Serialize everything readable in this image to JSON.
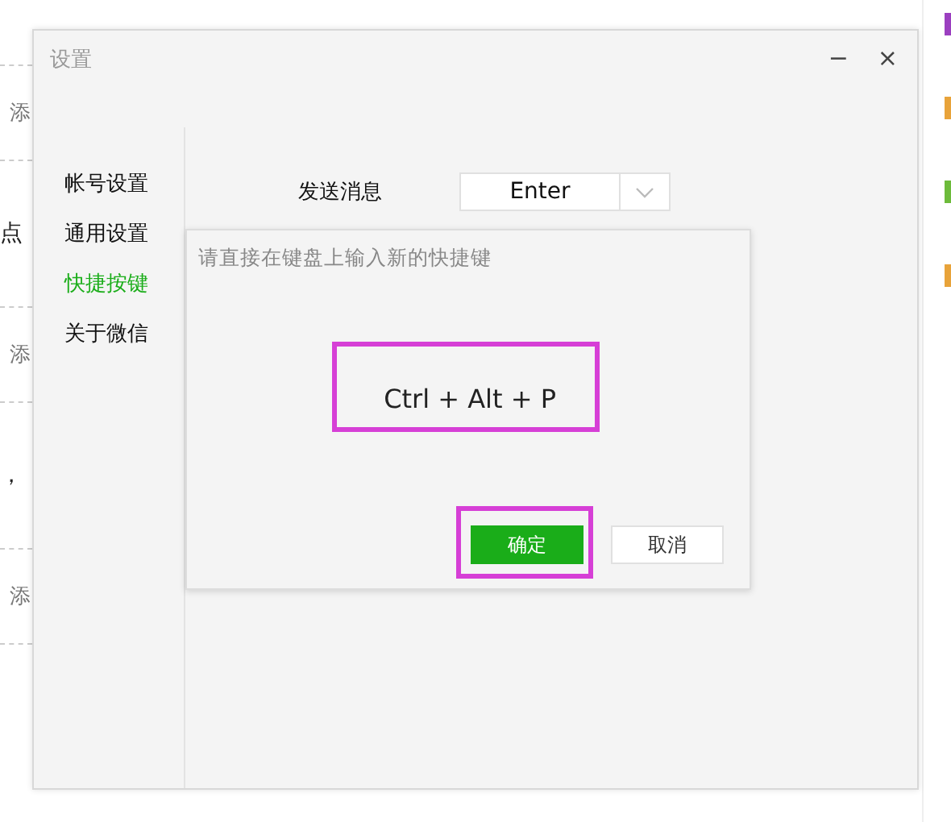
{
  "background": {
    "fragments": [
      {
        "text": "添",
        "kind": "box"
      },
      {
        "text": "点",
        "kind": "plain"
      },
      {
        "text": "添",
        "kind": "box"
      },
      {
        "text": "，",
        "kind": "plain"
      },
      {
        "text": "添",
        "kind": "box"
      }
    ],
    "side_marks": [
      {
        "color": "#9b3fc0"
      },
      {
        "color": "#e8a33a"
      },
      {
        "color": "#6dbb3b"
      },
      {
        "color": "#e8a33a"
      }
    ]
  },
  "window": {
    "title": "设置",
    "minimize": "−",
    "close": "×"
  },
  "sidebar": {
    "items": [
      {
        "label": "帐号设置",
        "selected": false
      },
      {
        "label": "通用设置",
        "selected": false
      },
      {
        "label": "快捷按键",
        "selected": true
      },
      {
        "label": "关于微信",
        "selected": false
      }
    ]
  },
  "settings": [
    {
      "label": "发送消息",
      "value": "Enter"
    }
  ],
  "shortcut_dialog": {
    "prompt": "请直接在键盘上输入新的快捷键",
    "shortcut": "Ctrl + Alt + P",
    "shortcut_highlighted": true,
    "buttons": [
      {
        "label": "确定",
        "kind": "primary",
        "highlighted": true
      },
      {
        "label": "取消",
        "kind": "secondary",
        "highlighted": false
      }
    ]
  }
}
